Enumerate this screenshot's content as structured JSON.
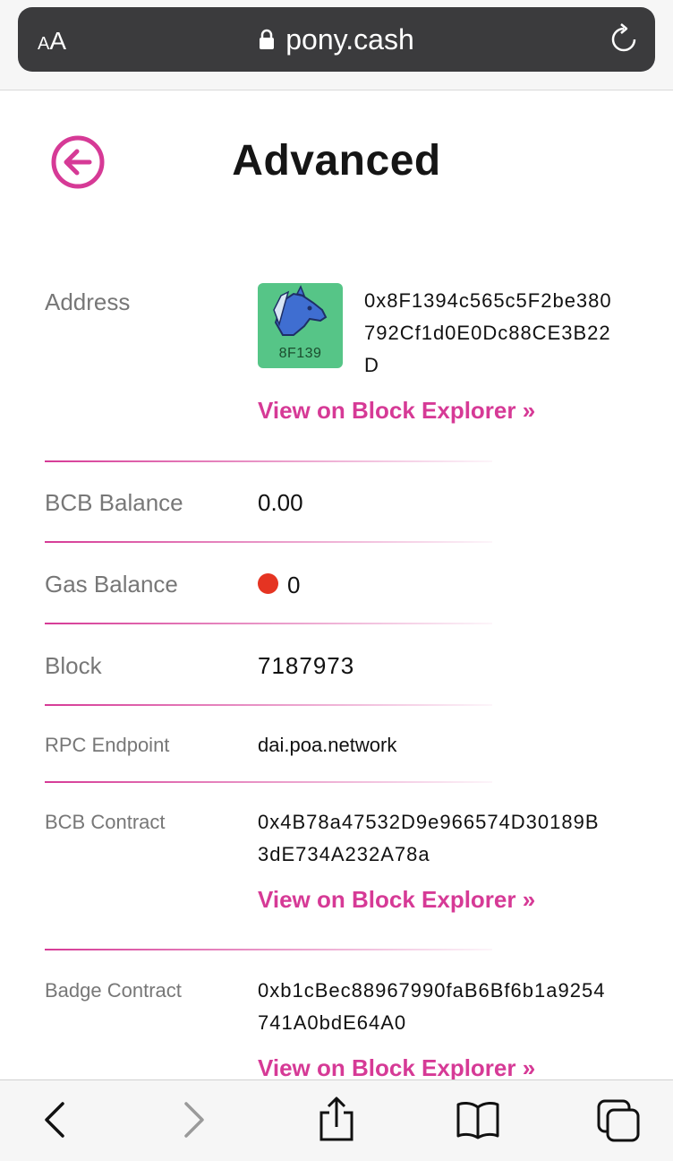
{
  "browser": {
    "aa_small": "A",
    "aa_large": "A",
    "url": "pony.cash"
  },
  "page": {
    "title": "Advanced"
  },
  "fields": {
    "address": {
      "label": "Address",
      "avatar_id": "8F139",
      "line1": "0x8F1394c565c5F2be380",
      "line2": "792Cf1d0E0Dc88CE3B22",
      "line3": "D",
      "link": "View on Block Explorer »"
    },
    "bcb_balance": {
      "label": "BCB Balance",
      "value": "0.00"
    },
    "gas_balance": {
      "label": "Gas Balance",
      "value": "0",
      "status_color": "#e53422"
    },
    "block": {
      "label": "Block",
      "value": "7187973"
    },
    "rpc_endpoint": {
      "label": "RPC Endpoint",
      "value": "dai.poa.network"
    },
    "bcb_contract": {
      "label": "BCB Contract",
      "line1": "0x4B78a47532D9e966574D30189B",
      "line2": "3dE734A232A78a",
      "link": "View on Block Explorer »"
    },
    "badge_contract": {
      "label": "Badge Contract",
      "line1": "0xb1cBec88967990faB6Bf6b1a9254",
      "line2": "741A0bdE64A0",
      "link": "View on Block Explorer »"
    }
  },
  "colors": {
    "accent": "#d63a96",
    "avatar_bg": "#56c587",
    "urlbar_bg": "#3b3b3d"
  },
  "icons": {
    "back": "back-arrow-circle-icon",
    "lock": "lock-icon",
    "reload": "reload-icon",
    "avatar": "pony-avatar-icon",
    "nav_back": "chevron-left-icon",
    "nav_forward": "chevron-right-icon",
    "share": "share-icon",
    "bookmarks": "book-icon",
    "tabs": "tabs-icon"
  }
}
